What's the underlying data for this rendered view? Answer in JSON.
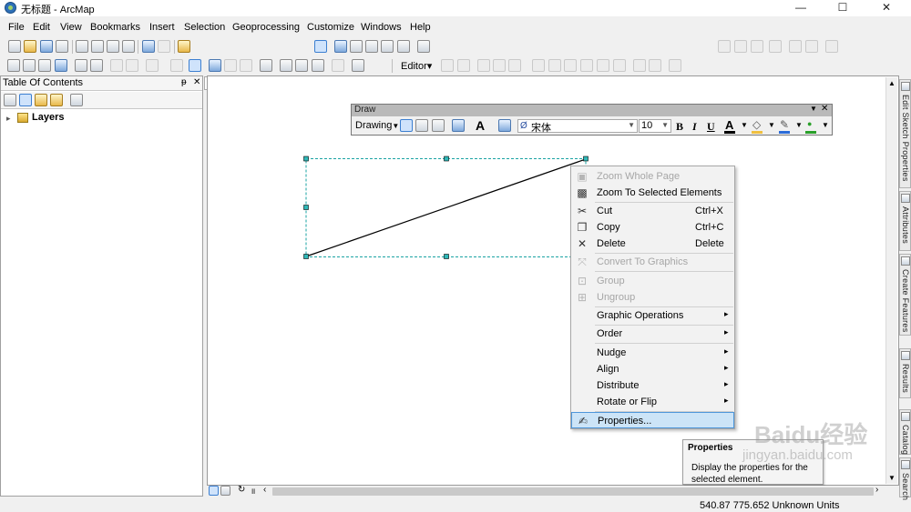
{
  "window": {
    "title": "无标题 - ArcMap",
    "app_icon": "arcmap-globe-icon",
    "minimize": "—",
    "maximize": "☐",
    "close": "✕"
  },
  "menubar": {
    "items": [
      "File",
      "Edit",
      "View",
      "Bookmarks",
      "Insert",
      "Selection",
      "Geoprocessing",
      "Customize",
      "Windows",
      "Help"
    ]
  },
  "editor_toolbar": {
    "label": "Editor",
    "arrow": "▾"
  },
  "toc": {
    "title": "Table Of Contents",
    "pin": "ᵽ",
    "close": "✕",
    "root_layer": "Layers"
  },
  "draw_toolbar": {
    "title": "Draw",
    "drawing_label": "Drawing",
    "font_name": "宋体",
    "font_size": "10",
    "bold": "B",
    "italic": "I",
    "underline": "U",
    "font_color_label": "A",
    "colors": {
      "font": "#000000",
      "fill": "#f0c040",
      "line": "#2a6bd8",
      "marker": "#2aa02a"
    }
  },
  "context_menu": {
    "items": [
      {
        "label": "Zoom Whole Page",
        "enabled": false,
        "icon": "zoom-page-icon"
      },
      {
        "label": "Zoom To Selected Elements",
        "enabled": true,
        "icon": "zoom-selected-icon"
      },
      {
        "label": "Cut",
        "shortcut": "Ctrl+X",
        "enabled": true,
        "icon": "scissors-icon"
      },
      {
        "label": "Copy",
        "shortcut": "Ctrl+C",
        "enabled": true,
        "icon": "copy-icon"
      },
      {
        "label": "Delete",
        "shortcut": "Delete",
        "enabled": true,
        "icon": "delete-icon"
      },
      {
        "label": "Convert To Graphics",
        "enabled": false,
        "icon": "convert-icon"
      },
      {
        "label": "Group",
        "enabled": false,
        "icon": "group-icon"
      },
      {
        "label": "Ungroup",
        "enabled": false,
        "icon": "ungroup-icon"
      },
      {
        "label": "Graphic Operations",
        "enabled": true,
        "submenu": true
      },
      {
        "label": "Order",
        "enabled": true,
        "submenu": true
      },
      {
        "label": "Nudge",
        "enabled": true,
        "submenu": true
      },
      {
        "label": "Align",
        "enabled": true,
        "submenu": true
      },
      {
        "label": "Distribute",
        "enabled": true,
        "submenu": true
      },
      {
        "label": "Rotate or Flip",
        "enabled": true,
        "submenu": true
      },
      {
        "label": "Properties...",
        "enabled": true,
        "icon": "properties-icon",
        "highlighted": true
      }
    ],
    "submenu_arrow": "▸"
  },
  "tooltip": {
    "title": "Properties",
    "description": "Display the properties for the selected element."
  },
  "status_bar": {
    "coordinates": "540.87  775.652 Unknown Units"
  },
  "right_dock_tabs": [
    "Edit Sketch Properties",
    "Attributes",
    "Create Features",
    "Results",
    "Catalog",
    "Search"
  ],
  "watermark": {
    "brand": "Baidu",
    "cn": "经验",
    "url": "jingyan.baidu.com"
  }
}
